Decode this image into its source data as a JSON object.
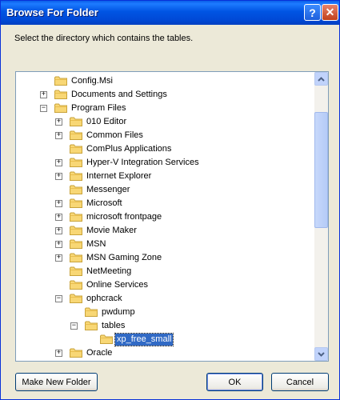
{
  "window": {
    "title": "Browse For Folder",
    "help_glyph": "?",
    "close_glyph": "✕"
  },
  "instruction": "Select the directory which contains the tables.",
  "tree": {
    "items": [
      {
        "label": "Config.Msi",
        "expander": ""
      },
      {
        "label": "Documents and Settings",
        "expander": "+"
      },
      {
        "label": "Program Files",
        "expander": "−"
      },
      {
        "label": "010 Editor",
        "expander": "+"
      },
      {
        "label": "Common Files",
        "expander": "+"
      },
      {
        "label": "ComPlus Applications",
        "expander": ""
      },
      {
        "label": "Hyper-V Integration Services",
        "expander": "+"
      },
      {
        "label": "Internet Explorer",
        "expander": "+"
      },
      {
        "label": "Messenger",
        "expander": ""
      },
      {
        "label": "Microsoft",
        "expander": "+"
      },
      {
        "label": "microsoft frontpage",
        "expander": "+"
      },
      {
        "label": "Movie Maker",
        "expander": "+"
      },
      {
        "label": "MSN",
        "expander": "+"
      },
      {
        "label": "MSN Gaming Zone",
        "expander": "+"
      },
      {
        "label": "NetMeeting",
        "expander": ""
      },
      {
        "label": "Online Services",
        "expander": ""
      },
      {
        "label": "ophcrack",
        "expander": "−"
      },
      {
        "label": "pwdump",
        "expander": ""
      },
      {
        "label": "tables",
        "expander": "−"
      },
      {
        "label": "xp_free_small",
        "expander": "",
        "selected": true
      },
      {
        "label": "Oracle",
        "expander": "+"
      }
    ]
  },
  "buttons": {
    "new_folder": "Make New Folder",
    "ok": "OK",
    "cancel": "Cancel"
  },
  "icons": {
    "folder": "folder-icon",
    "help": "help-icon",
    "close": "close-icon"
  }
}
